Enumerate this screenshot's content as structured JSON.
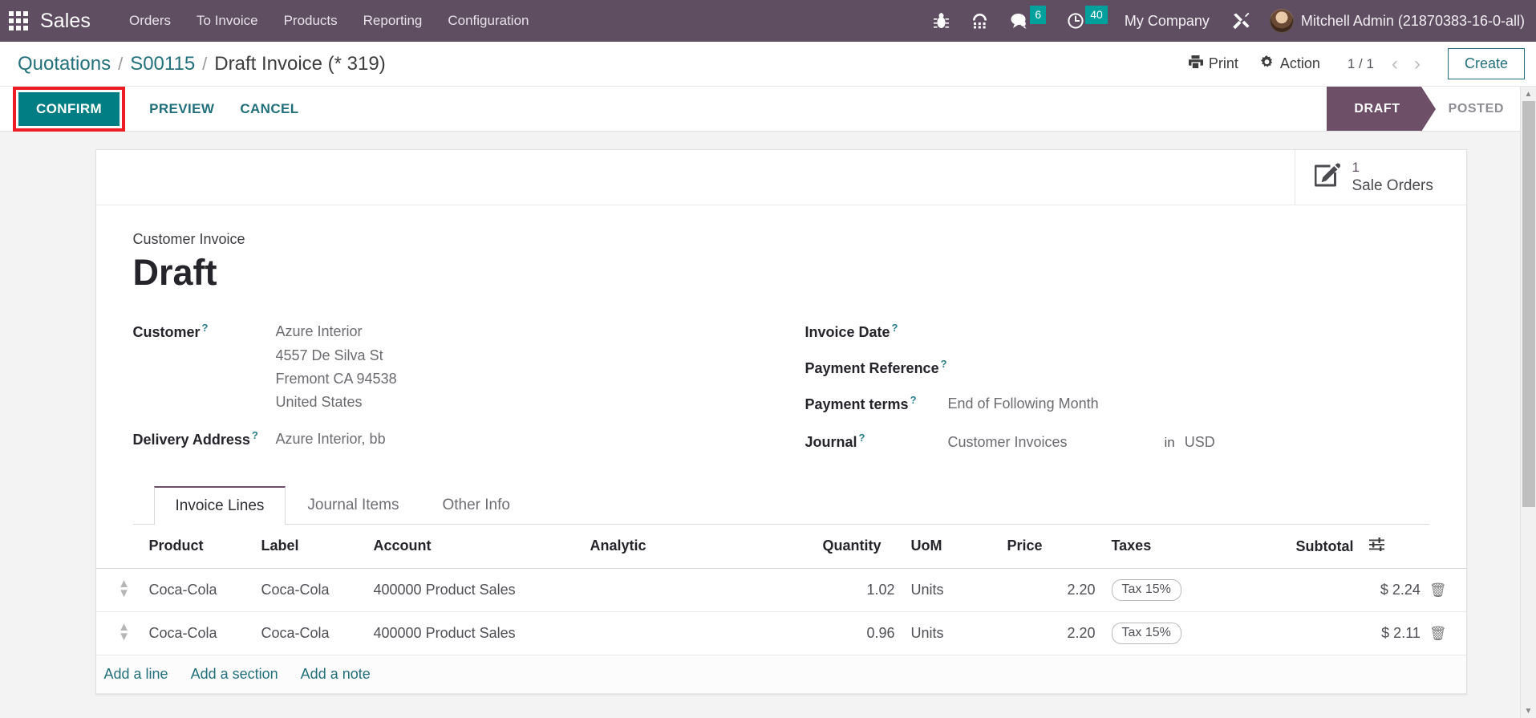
{
  "navbar": {
    "apps_icon": "apps-grid-icon",
    "brand": "Sales",
    "menus": [
      {
        "label": "Orders"
      },
      {
        "label": "To Invoice"
      },
      {
        "label": "Products"
      },
      {
        "label": "Reporting"
      },
      {
        "label": "Configuration"
      }
    ],
    "icons": [
      {
        "name": "bug-icon"
      },
      {
        "name": "dialpad-icon"
      }
    ],
    "messages": {
      "icon": "chat-icon",
      "count": "6"
    },
    "activities": {
      "icon": "clock-icon",
      "count": "40"
    },
    "company": "My Company",
    "debug": {
      "icon": "wrench-screwdriver-icon"
    },
    "user": "Mitchell Admin (21870383-16-0-all)",
    "accent_teal": "#00a09d",
    "bar_color": "#5f4d62"
  },
  "control_panel": {
    "breadcrumb": [
      {
        "label": "Quotations",
        "link": true
      },
      {
        "label": "S00115",
        "link": true
      },
      {
        "label": "Draft Invoice (* 319)",
        "link": false
      }
    ],
    "separator": "/",
    "print_label": "Print",
    "print_icon": "printer-icon",
    "action_label": "Action",
    "action_icon": "gear-icon",
    "pager": "1 / 1",
    "prev_icon": "chevron-left-icon",
    "next_icon": "chevron-right-icon",
    "create_label": "Create"
  },
  "statusbar": {
    "confirm_label": "CONFIRM",
    "preview_label": "PREVIEW",
    "cancel_label": "CANCEL",
    "highlight_color": "#ec1c24",
    "confirm_color": "#017e84",
    "steps": [
      {
        "label": "DRAFT",
        "active": true
      },
      {
        "label": "POSTED",
        "active": false
      }
    ]
  },
  "smart_buttons": [
    {
      "icon": "pencil-square-icon",
      "value": "1",
      "label": "Sale Orders"
    }
  ],
  "form": {
    "subtitle": "Customer Invoice",
    "title": "Draft",
    "left_fields": [
      {
        "label": "Customer",
        "help": "?",
        "value_lines": [
          "Azure Interior",
          "4557 De Silva St",
          "Fremont CA 94538",
          "United States"
        ]
      },
      {
        "label": "Delivery Address",
        "help": "?",
        "value_lines": [
          "Azure Interior, bb"
        ]
      }
    ],
    "right_fields": [
      {
        "label": "Invoice Date",
        "help": "?",
        "value": ""
      },
      {
        "label": "Payment Reference",
        "help": "?",
        "value": ""
      },
      {
        "label": "Payment terms",
        "help": "?",
        "value": "End of Following Month"
      },
      {
        "label": "Journal",
        "help": "?",
        "value": "Customer Invoices",
        "suffix_label": "in",
        "suffix_value": "USD"
      }
    ]
  },
  "notebook": {
    "tabs": [
      {
        "label": "Invoice Lines",
        "active": true
      },
      {
        "label": "Journal Items",
        "active": false
      },
      {
        "label": "Other Info",
        "active": false
      }
    ]
  },
  "lines_table": {
    "columns": [
      "Product",
      "Label",
      "Account",
      "Analytic",
      "Quantity",
      "UoM",
      "Price",
      "Taxes",
      "Subtotal"
    ],
    "optional_columns_icon": "sliders-icon",
    "drag_handle_icon": "drag-handle-icon",
    "delete_icon": "trash-icon",
    "rows": [
      {
        "product": "Coca-Cola",
        "label": "Coca-Cola",
        "account": "400000 Product Sales",
        "analytic": "",
        "quantity": "1.02",
        "uom": "Units",
        "price": "2.20",
        "taxes": "Tax 15%",
        "subtotal": "$ 2.24"
      },
      {
        "product": "Coca-Cola",
        "label": "Coca-Cola",
        "account": "400000 Product Sales",
        "analytic": "",
        "quantity": "0.96",
        "uom": "Units",
        "price": "2.20",
        "taxes": "Tax 15%",
        "subtotal": "$ 2.11"
      }
    ],
    "add_line": "Add a line",
    "add_section": "Add a section",
    "add_note": "Add a note"
  }
}
